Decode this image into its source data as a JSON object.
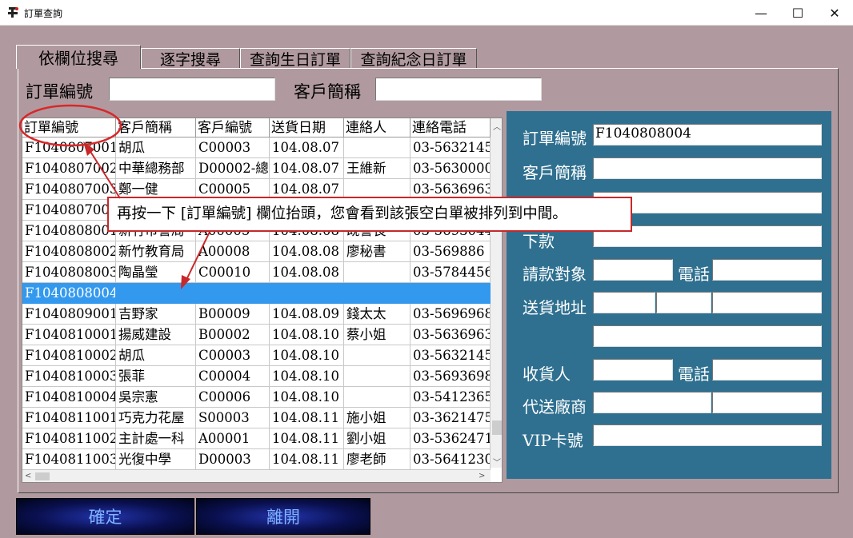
{
  "window": {
    "title": "訂單查詢",
    "minimize": "—",
    "maximize": "☐",
    "close": "✕"
  },
  "tabs": [
    {
      "label": "依欄位搜尋",
      "active": true
    },
    {
      "label": "逐字搜尋",
      "active": false
    },
    {
      "label": "查詢生日訂單",
      "active": false
    },
    {
      "label": "查詢紀念日訂單",
      "active": false
    }
  ],
  "search": {
    "order_no_label": "訂單編號",
    "order_no_value": "",
    "customer_label": "客戶簡稱",
    "customer_value": ""
  },
  "grid": {
    "columns": [
      "訂單編號",
      "客戶簡稱",
      "客戶編號",
      "送貨日期",
      "連絡人",
      "連絡電話"
    ],
    "rows": [
      [
        "F1040807001",
        "胡瓜",
        "C00003",
        "104.08.07",
        "",
        "03-5632145"
      ],
      [
        "F1040807002",
        "中華總務部",
        "D00002-總",
        "104.08.07",
        "王維新",
        "03-5630000"
      ],
      [
        "F1040807003",
        "鄭一健",
        "C00005",
        "104.08.07",
        "",
        "03-5636963"
      ],
      [
        "F1040807004",
        "",
        "",
        "",
        "",
        ""
      ],
      [
        "F1040808001",
        "新竹市警局",
        "A00005",
        "104.08.08",
        "既警長",
        "03-5693044"
      ],
      [
        "F1040808002",
        "新竹教育局",
        "A00008",
        "104.08.08",
        "廖秘書",
        "03-569886"
      ],
      [
        "F1040808003",
        "陶晶瑩",
        "C00010",
        "104.08.08",
        "",
        "03-5784456"
      ],
      [
        "F1040808004",
        "",
        "",
        "",
        "",
        ""
      ],
      [
        "F1040809001",
        "吉野家",
        "B00009",
        "104.08.09",
        "錢太太",
        "03-5696968"
      ],
      [
        "F1040810001",
        "揚威建設",
        "B00002",
        "104.08.10",
        "蔡小姐",
        "03-5636963"
      ],
      [
        "F1040810002",
        "胡瓜",
        "C00003",
        "104.08.10",
        "",
        "03-5632145"
      ],
      [
        "F1040810003",
        "張菲",
        "C00004",
        "104.08.10",
        "",
        "03-5693698"
      ],
      [
        "F1040810004",
        "吳宗憲",
        "C00006",
        "104.08.10",
        "",
        "03-5412365"
      ],
      [
        "F1040811001",
        "巧克力花屋",
        "S00003",
        "104.08.11",
        "施小姐",
        "03-3621475"
      ],
      [
        "F1040811002",
        "主計處一科",
        "A00001",
        "104.08.11",
        "劉小姐",
        "03-5362471"
      ],
      [
        "F1040811003",
        "光復中學",
        "D00003",
        "104.08.11",
        "廖老師",
        "03-5641230"
      ]
    ],
    "selected_row": 7,
    "scroll_up": "︿",
    "scroll_down": "﹀",
    "scroll_left": "<",
    "scroll_right": ">"
  },
  "detail": {
    "order_no_label": "訂單編號",
    "order_no_value": "F1040808004",
    "customer_label": "客戶簡稱",
    "deposit_label": "下款",
    "billing_label": "請款對象",
    "phone_label": "電話",
    "address_label": "送貨地址",
    "receiver_label": "收貨人",
    "receiver_phone_label": "電話",
    "vendor_label": "代送廠商",
    "vip_label": "VIP卡號"
  },
  "buttons": {
    "ok": "確定",
    "exit": "離開"
  },
  "annotation": {
    "text": "再按一下 [訂單編號] 欄位抬頭，您會看到該張空白單被排列到中間。"
  },
  "colors": {
    "window_bg": "#b09a9f",
    "detail_bg": "#2f7090",
    "selection": "#3399ee",
    "annotation": "#c8282a"
  }
}
